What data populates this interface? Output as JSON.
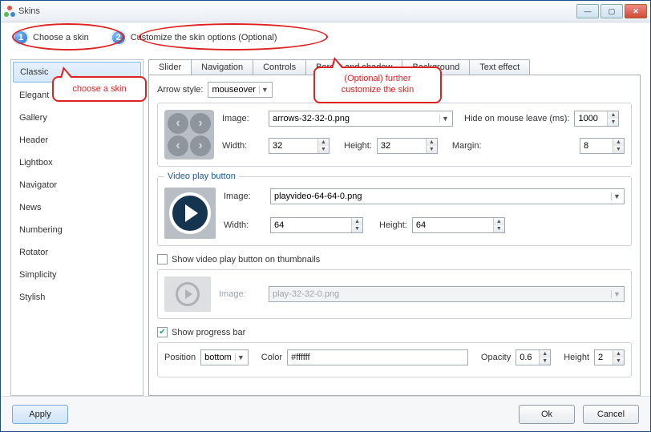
{
  "window": {
    "title": "Skins"
  },
  "steps": {
    "one_num": "1",
    "one_label": "Choose a skin",
    "two_num": "2",
    "two_label": "Customize the skin options (Optional)"
  },
  "callouts": {
    "choose": "choose a skin",
    "customize": "(Optional) further customize the skin"
  },
  "skins": [
    "Classic",
    "Elegant",
    "Gallery",
    "Header",
    "Lightbox",
    "Navigator",
    "News",
    "Numbering",
    "Rotator",
    "Simplicity",
    "Stylish"
  ],
  "skin_selected_index": 0,
  "tabs": [
    "Slider",
    "Navigation",
    "Controls",
    "Border and shadow",
    "Background",
    "Text effect"
  ],
  "tab_active_index": 0,
  "arrow": {
    "label_style": "Arrow style:",
    "style_value": "mouseover",
    "label_image": "Image:",
    "image_value": "arrows-32-32-0.png",
    "label_hide": "Hide on mouse leave (ms):",
    "hide_value": "1000",
    "label_width": "Width:",
    "width_value": "32",
    "label_height": "Height:",
    "height_value": "32",
    "label_margin": "Margin:",
    "margin_value": "8"
  },
  "video": {
    "legend": "Video play button",
    "label_image": "Image:",
    "image_value": "playvideo-64-64-0.png",
    "label_width": "Width:",
    "width_value": "64",
    "label_height": "Height:",
    "height_value": "64"
  },
  "thumb_play": {
    "check_label": "Show video play button on thumbnails",
    "checked": false,
    "label_image": "Image:",
    "image_value": "play-32-32-0.png"
  },
  "progress": {
    "check_label": "Show progress bar",
    "checked": true,
    "label_position": "Position",
    "position_value": "bottom",
    "label_color": "Color",
    "color_value": "#ffffff",
    "label_opacity": "Opacity",
    "opacity_value": "0.6",
    "label_height": "Height",
    "height_value": "2"
  },
  "buttons": {
    "apply": "Apply",
    "ok": "Ok",
    "cancel": "Cancel"
  }
}
